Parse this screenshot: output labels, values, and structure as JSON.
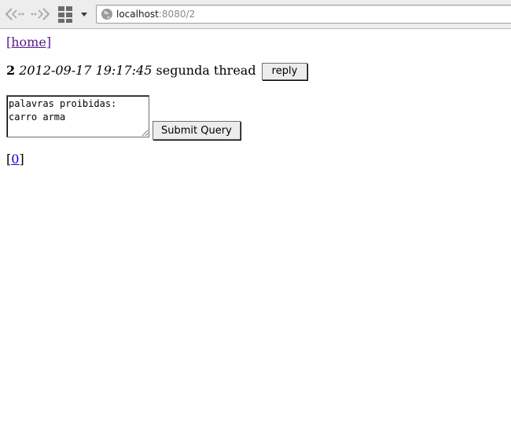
{
  "browser": {
    "url_host": "localhost",
    "url_rest": ":8080/2"
  },
  "page": {
    "home_link": "[home]",
    "post": {
      "id": "2",
      "date": "2012-09-17 19:17:45",
      "title": "segunda thread",
      "reply_label": "reply"
    },
    "form": {
      "textarea_value": "palavras proibidas:\ncarro arma",
      "submit_label": "Submit Query"
    },
    "pager": {
      "open": "[",
      "link": "0",
      "close": "]"
    }
  },
  "colors": {
    "visited_link": "#551a8b",
    "link": "#0000ee",
    "toolbar_bg": "#ededed"
  }
}
